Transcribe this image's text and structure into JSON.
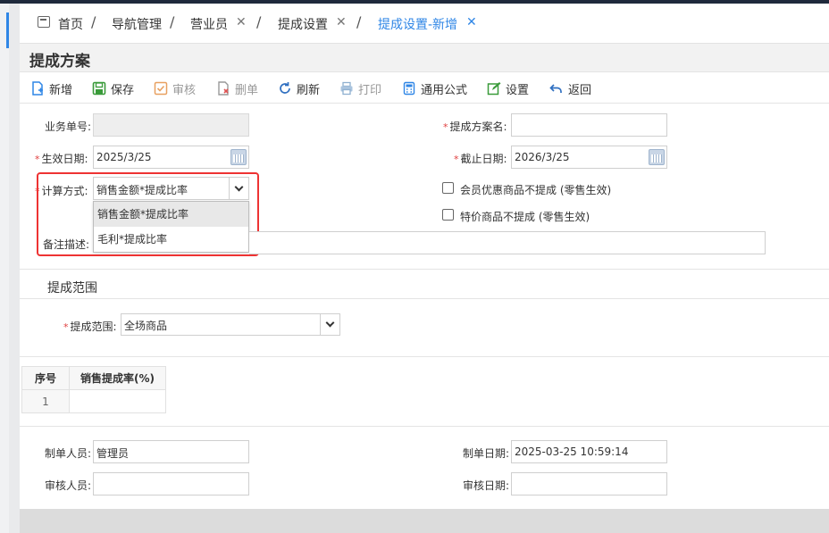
{
  "breadcrumb": {
    "items": [
      {
        "label": "首页",
        "closable": false,
        "active": false
      },
      {
        "label": "导航管理",
        "closable": false,
        "active": false
      },
      {
        "label": "营业员",
        "closable": true,
        "active": false
      },
      {
        "label": "提成设置",
        "closable": true,
        "active": false
      },
      {
        "label": "提成设置-新增",
        "closable": true,
        "active": true
      }
    ]
  },
  "panel": {
    "title": "提成方案"
  },
  "toolbar": {
    "new": "新增",
    "save": "保存",
    "audit": "审核",
    "delete": "删单",
    "refresh": "刷新",
    "print": "打印",
    "formula": "通用公式",
    "settings": "设置",
    "back": "返回"
  },
  "form": {
    "doc_no_label": "业务单号:",
    "doc_no_value": "",
    "scheme_name_label": "提成方案名:",
    "scheme_name_value": "",
    "effective_date_label": "生效日期:",
    "effective_date_value": "2025/3/25",
    "end_date_label": "截止日期:",
    "end_date_value": "2026/3/25",
    "calc_method_label": "计算方式:",
    "calc_method_value": "销售金额*提成比率",
    "calc_method_options": [
      "销售金额*提成比率",
      "毛利*提成比率"
    ],
    "member_discount_label": "会员优惠商品不提成 (零售生效)",
    "special_price_label": "特价商品不提成 (零售生效)",
    "remark_label": "备注描述:",
    "remark_value": ""
  },
  "scope": {
    "section_title": "提成范围",
    "scope_label": "提成范围:",
    "scope_value": "全场商品"
  },
  "table": {
    "headers": [
      "序号",
      "销售提成率(%)"
    ],
    "rows": [
      [
        "1",
        ""
      ]
    ]
  },
  "footer": {
    "creator_label": "制单人员:",
    "creator_value": "管理员",
    "create_date_label": "制单日期:",
    "create_date_value": "2025-03-25 10:59:14",
    "auditor_label": "审核人员:",
    "auditor_value": "",
    "audit_date_label": "审核日期:",
    "audit_date_value": ""
  },
  "colors": {
    "accent": "#2f86e6",
    "required": "#e04040",
    "highlight": "#e33333"
  }
}
